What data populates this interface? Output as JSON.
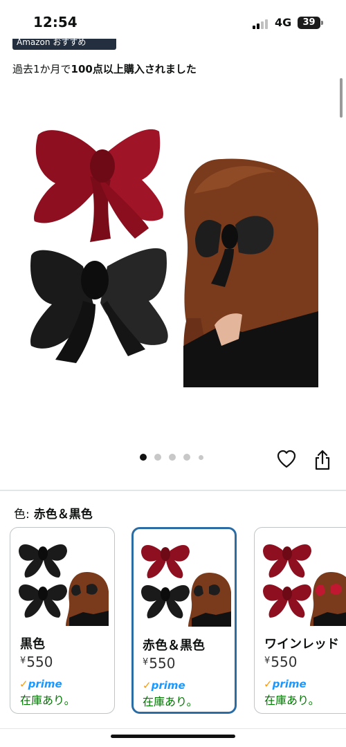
{
  "status": {
    "time": "12:54",
    "network": "4G",
    "battery": "39"
  },
  "badge": {
    "label": "Amazon おすすめ"
  },
  "purchase_info": {
    "prefix": "過去1か月で",
    "emphasis": "100点以上購入されました"
  },
  "carousel": {
    "total_images": 5,
    "current_index": 1
  },
  "actions": {
    "wishlist_icon": "heart-icon",
    "share_icon": "share-icon"
  },
  "color_selector": {
    "label": "色:",
    "selected": "赤色＆黒色"
  },
  "variants": [
    {
      "name": "黒色",
      "currency": "¥",
      "price": "550",
      "prime": "prime",
      "stock": "在庫あり。",
      "selected": false
    },
    {
      "name": "赤色＆黒色",
      "currency": "¥",
      "price": "550",
      "prime": "prime",
      "stock": "在庫あり。",
      "selected": true
    },
    {
      "name": "ワインレッド",
      "currency": "¥",
      "price": "550",
      "prime": "prime",
      "stock": "在庫あり。",
      "selected": false
    }
  ],
  "colors": {
    "selected_border": "#2a6ca3",
    "prime_blue": "#1a98ff",
    "prime_check": "#ff9900",
    "in_stock": "#007600",
    "bow_red": "#8e1020",
    "bow_black": "#1a1a1a",
    "hair": "#7a3a1c"
  }
}
